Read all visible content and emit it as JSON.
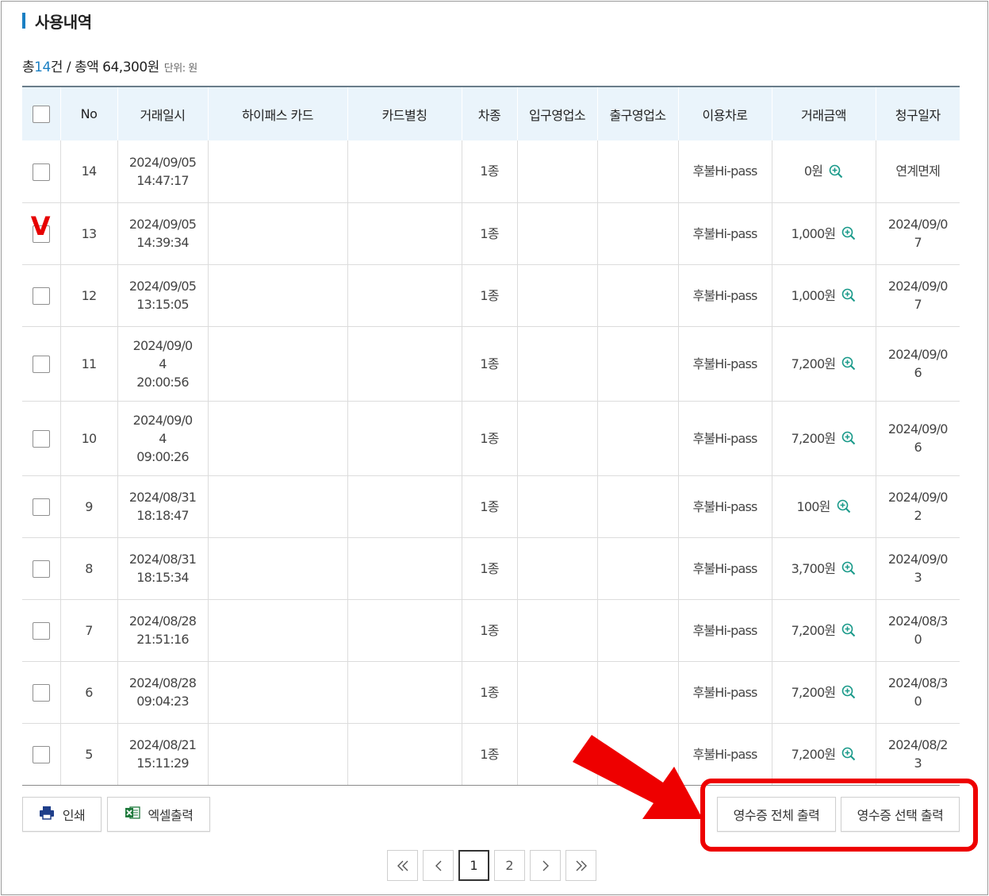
{
  "section": {
    "title": "사용내역",
    "summary_prefix": "총 ",
    "count": "14",
    "count_unit": "건",
    "separator": " / ",
    "total_label": "총액 ",
    "total_amount": "64,300원",
    "unit_label": "단위: 원"
  },
  "table": {
    "headers": [
      "No",
      "거래일시",
      "하이패스 카드",
      "카드별칭",
      "차종",
      "입구영업소",
      "출구영업소",
      "이용차로",
      "거래금액",
      "청구일자"
    ],
    "rows": [
      {
        "no": "14",
        "datetime_1": "2024/09/05",
        "datetime_2": "14:47:17",
        "datetime_3": "",
        "card": "",
        "alias": "",
        "type": "1종",
        "entry": "",
        "exit": "",
        "lane": "후불Hi-pass",
        "amount": "0원",
        "billing_1": "연계면제",
        "billing_2": ""
      },
      {
        "no": "13",
        "datetime_1": "2024/09/05",
        "datetime_2": "14:39:34",
        "datetime_3": "",
        "card": "",
        "alias": "",
        "type": "1종",
        "entry": "",
        "exit": "",
        "lane": "후불Hi-pass",
        "amount": "1,000원",
        "billing_1": "2024/09/0",
        "billing_2": "7"
      },
      {
        "no": "12",
        "datetime_1": "2024/09/05",
        "datetime_2": "13:15:05",
        "datetime_3": "",
        "card": "",
        "alias": "",
        "type": "1종",
        "entry": "",
        "exit": "",
        "lane": "후불Hi-pass",
        "amount": "1,000원",
        "billing_1": "2024/09/0",
        "billing_2": "7"
      },
      {
        "no": "11",
        "datetime_1": "2024/09/0",
        "datetime_2": "4",
        "datetime_3": "20:00:56",
        "card": "",
        "alias": "",
        "type": "1종",
        "entry": "",
        "exit": "",
        "lane": "후불Hi-pass",
        "amount": "7,200원",
        "billing_1": "2024/09/0",
        "billing_2": "6"
      },
      {
        "no": "10",
        "datetime_1": "2024/09/0",
        "datetime_2": "4",
        "datetime_3": "09:00:26",
        "card": "",
        "alias": "",
        "type": "1종",
        "entry": "",
        "exit": "",
        "lane": "후불Hi-pass",
        "amount": "7,200원",
        "billing_1": "2024/09/0",
        "billing_2": "6"
      },
      {
        "no": "9",
        "datetime_1": "2024/08/31",
        "datetime_2": "18:18:47",
        "datetime_3": "",
        "card": "",
        "alias": "",
        "type": "1종",
        "entry": "",
        "exit": "",
        "lane": "후불Hi-pass",
        "amount": "100원",
        "billing_1": "2024/09/0",
        "billing_2": "2"
      },
      {
        "no": "8",
        "datetime_1": "2024/08/31",
        "datetime_2": "18:15:34",
        "datetime_3": "",
        "card": "",
        "alias": "",
        "type": "1종",
        "entry": "",
        "exit": "",
        "lane": "후불Hi-pass",
        "amount": "3,700원",
        "billing_1": "2024/09/0",
        "billing_2": "3"
      },
      {
        "no": "7",
        "datetime_1": "2024/08/28",
        "datetime_2": "21:51:16",
        "datetime_3": "",
        "card": "",
        "alias": "",
        "type": "1종",
        "entry": "",
        "exit": "",
        "lane": "후불Hi-pass",
        "amount": "7,200원",
        "billing_1": "2024/08/3",
        "billing_2": "0"
      },
      {
        "no": "6",
        "datetime_1": "2024/08/28",
        "datetime_2": "09:04:23",
        "datetime_3": "",
        "card": "",
        "alias": "",
        "type": "1종",
        "entry": "",
        "exit": "",
        "lane": "후불Hi-pass",
        "amount": "7,200원",
        "billing_1": "2024/08/3",
        "billing_2": "0"
      },
      {
        "no": "5",
        "datetime_1": "2024/08/21",
        "datetime_2": "15:11:29",
        "datetime_3": "",
        "card": "",
        "alias": "",
        "type": "1종",
        "entry": "",
        "exit": "",
        "lane": "후불Hi-pass",
        "amount": "7,200원",
        "billing_1": "2024/08/2",
        "billing_2": "3"
      }
    ]
  },
  "annotation": {
    "check_mark": "V",
    "check_mark_color": "#e60000",
    "highlight_color": "#ee0000"
  },
  "buttons": {
    "print": "인쇄",
    "excel": "엑셀출력",
    "receipt_all": "영수증 전체 출력",
    "receipt_selected": "영수증 선택 출력"
  },
  "pagination": {
    "pages": [
      "1",
      "2"
    ],
    "current": "1"
  },
  "colors": {
    "accent": "#1a7fc3",
    "header_bg": "#eaf4fb"
  }
}
